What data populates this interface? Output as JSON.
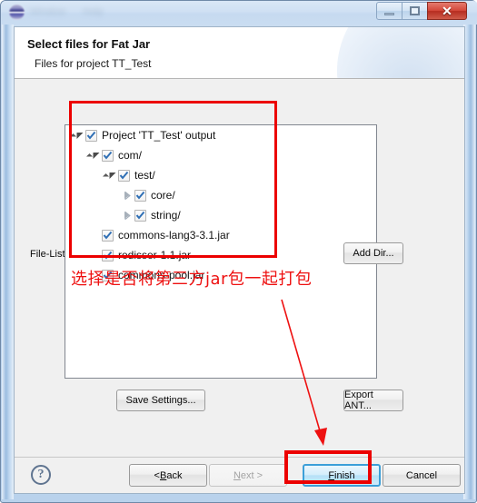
{
  "window": {
    "icon": "eclipse-app-icon",
    "ghost_menus": [
      "Window",
      "Help"
    ],
    "controls": {
      "minimize": "minimize-icon",
      "maximize": "maximize-icon",
      "close": "✕"
    }
  },
  "banner": {
    "title": "Select files for Fat Jar",
    "subtitle": "Files for project TT_Test"
  },
  "form": {
    "filelist_label": "File-List:"
  },
  "tree": {
    "items": [
      {
        "label": "Project 'TT_Test' output",
        "depth": 0,
        "twisty": "expanded",
        "checked": true
      },
      {
        "label": "com/",
        "depth": 1,
        "twisty": "expanded",
        "checked": true
      },
      {
        "label": "test/",
        "depth": 2,
        "twisty": "expanded",
        "checked": true
      },
      {
        "label": "core/",
        "depth": 3,
        "twisty": "collapsed",
        "checked": true
      },
      {
        "label": "string/",
        "depth": 3,
        "twisty": "collapsed",
        "checked": true
      },
      {
        "label": "commons-lang3-3.1.jar",
        "depth": 1,
        "twisty": "none",
        "checked": true
      },
      {
        "label": "redisser-1.1.jar",
        "depth": 1,
        "twisty": "none",
        "checked": true
      },
      {
        "label": "commons-pool.jar",
        "depth": 1,
        "twisty": "none",
        "checked": true
      }
    ]
  },
  "annotations": {
    "note_text": "选择是否将第三方jar包一起打包",
    "color": "#ee1111",
    "box_color": "#ec0000"
  },
  "buttons": {
    "add_dir": "Add Dir...",
    "save_settings": "Save Settings...",
    "export_ant": "Export ANT...",
    "back": "< Back",
    "back_pre": "< ",
    "back_mn": "B",
    "back_post": "ack",
    "next": "Next >",
    "next_mn": "N",
    "next_post": "ext >",
    "finish": "Finish",
    "finish_mn": "F",
    "finish_post": "inish",
    "cancel": "Cancel",
    "help": "?"
  },
  "state": {
    "next_enabled": false,
    "finish_focused": true
  }
}
